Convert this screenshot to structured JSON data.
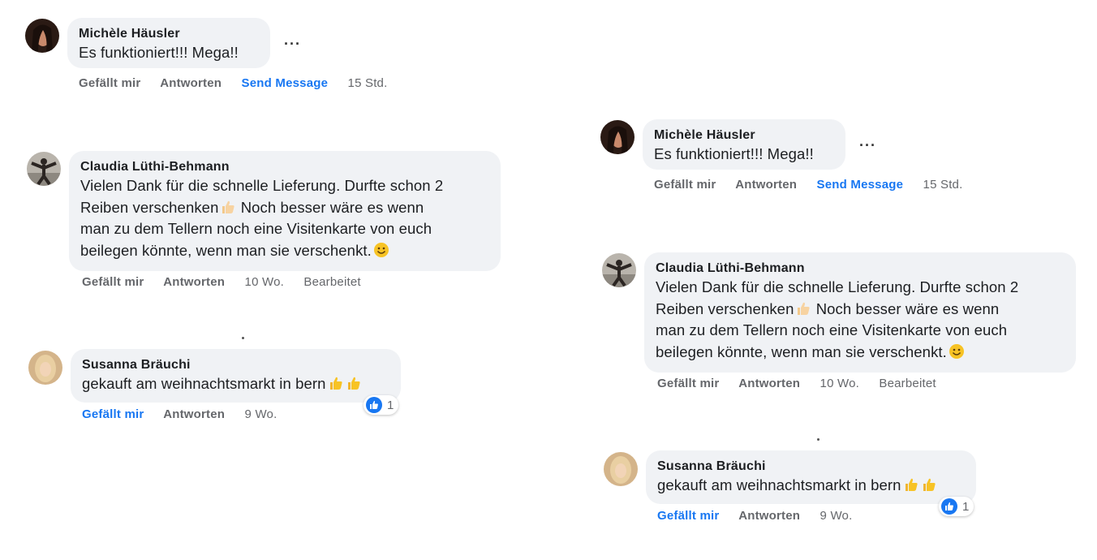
{
  "comments": [
    {
      "author": "Michèle Häusler",
      "lines": [
        "Es funktioniert!!! Mega!!"
      ],
      "actions": {
        "like": "Gefällt mir",
        "reply": "Antworten",
        "extra": "Send Message",
        "time": "15 Std."
      },
      "more": "···"
    },
    {
      "author": "Claudia Lüthi-Behmann",
      "lines": [
        "Vielen Dank für die schnelle Lieferung. Durfte schon 2",
        "Reiben verschenken",
        " Noch besser wäre es wenn",
        "man zu dem Tellern noch eine Visitenkarte von euch",
        "beilegen könnte, wenn man sie verschenkt."
      ],
      "actions": {
        "like": "Gefällt mir",
        "reply": "Antworten",
        "time": "10 Wo.",
        "edited": "Bearbeitet"
      }
    },
    {
      "author": "Susanna Bräuchi",
      "lines": [
        "gekauft am weihnachtsmarkt in bern"
      ],
      "actions": {
        "like": "Gefällt mir",
        "reply": "Antworten",
        "time": "9 Wo."
      },
      "reaction_count": "1"
    }
  ],
  "icons": {
    "thumbs": "thumbs-up-icon",
    "smile": "smile-icon",
    "like": "like-reaction-icon",
    "more": "more-options-icon"
  },
  "colors": {
    "link": "#1877f2",
    "bubble": "#f0f2f5",
    "meta": "#65676b"
  }
}
